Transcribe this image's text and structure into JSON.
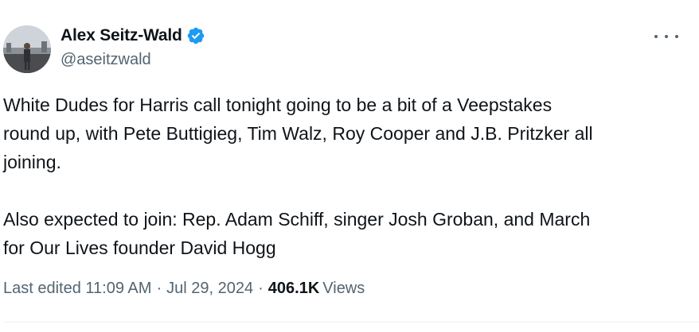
{
  "author": {
    "display_name": "Alex Seitz-Wald",
    "handle": "@aseitzwald",
    "verified": true,
    "verified_color": "#1d9bf0"
  },
  "tweet": {
    "paragraph1_lines": [
      "White Dudes for Harris call tonight going to be a bit of a Veepstakes",
      "round up, with Pete Buttigieg, Tim Walz, Roy Cooper and J.B. Pritzker all",
      "joining."
    ],
    "paragraph2_lines": [
      "Also expected to join: Rep. Adam Schiff, singer Josh Groban, and March",
      "for Our Lives founder David Hogg"
    ]
  },
  "meta": {
    "edited_label": "Last edited 11:09 AM",
    "separator": "·",
    "date": "Jul 29, 2024",
    "views_count": "406.1K",
    "views_label": "Views"
  },
  "icons": {
    "avatar": "avatar-photo",
    "verified": "verified-badge-icon",
    "more": "more-options-icon"
  }
}
